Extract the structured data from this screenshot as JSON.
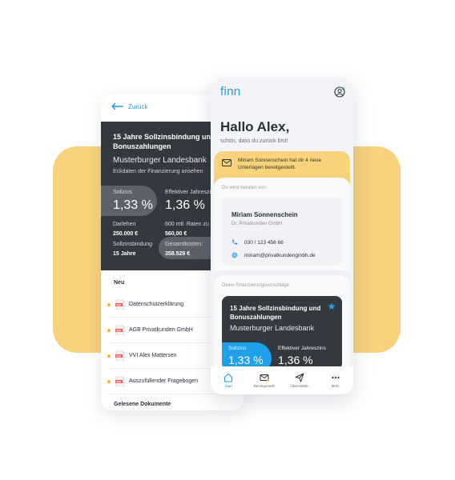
{
  "colors": {
    "accent": "#1f9ae0",
    "dark_card": "#34383f",
    "yellow": "#f8d37c",
    "pill_blue": "#21a0ea"
  },
  "back_screen": {
    "back_label": "Zurück",
    "financing": {
      "title": "15 Jahre Sollzinsbindung und Bonuszahlungen",
      "bank": "Musterburger Landesbank",
      "details_link": "Eckdaten der Finanzierung ansehen",
      "sollzins_label": "Sollzins",
      "sollzins_value": "1,33 %",
      "effektiv_label": "Effektiver Jahreszins",
      "effektiv_value": "1,36 %",
      "darlehen_label": "Darlehen",
      "darlehen_value": "250.000 €",
      "raten_label": "600 mtl. Raten zu",
      "raten_value": "560,00 €",
      "bindung_label": "Sollzinsbindung",
      "bindung_value": "15 Jahre",
      "gesamt_label": "Gesamtkosten:",
      "gesamt_value": "358.529 €"
    },
    "documents": {
      "new_header": "Neu",
      "items": [
        {
          "name": "Datenschutzerklärung",
          "date": ""
        },
        {
          "name": "AGB Privatkunden GmbH",
          "date": ""
        },
        {
          "name": "VVI Alex Mattersen",
          "date": "2"
        },
        {
          "name": "Auszufüllender Fragebogen",
          "date": "2"
        }
      ],
      "read_header": "Gelesene Dokumente"
    }
  },
  "front_screen": {
    "logo": "finn",
    "greeting": "Hallo Alex,",
    "greeting_sub": "schön, dass du zurück bist!",
    "notification": "Miriam Sonnenschein hat dir 4 neue Unterlagen bereitgestellt.",
    "advisor": {
      "section_label": "Du wirst beraten von:",
      "name": "Miriam Sonnenschein",
      "company": "Dr. Privatkunden GmbH",
      "phone": "030 / 123 456 66",
      "email": "miriam@privatkundengmbh.de"
    },
    "proposals": {
      "section_label": "Deine Finanzierungsvorschläge",
      "title": "15 Jahre Sollzinsbindung und Bonuszahlungen",
      "bank": "Musterburger Landesbank",
      "sollzins_label": "Sollzins",
      "sollzins_value": "1,33 %",
      "effektiv_label": "Effektiver Jahreszins",
      "effektiv_value": "1,36 %"
    },
    "nav": [
      {
        "label": "Start",
        "icon": "home-icon"
      },
      {
        "label": "Bereitgestellt",
        "icon": "mail-icon"
      },
      {
        "label": "Übermitteln",
        "icon": "send-icon"
      },
      {
        "label": "Mehr",
        "icon": "more-icon"
      }
    ]
  }
}
